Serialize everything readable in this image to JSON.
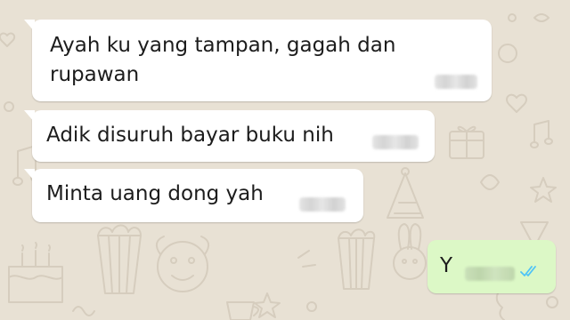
{
  "messages": [
    {
      "direction": "incoming",
      "text": "Ayah ku yang tampan, gagah dan\nrupawan"
    },
    {
      "direction": "incoming",
      "text": "Adik disuruh bayar buku nih"
    },
    {
      "direction": "incoming",
      "text": "Minta uang dong yah"
    },
    {
      "direction": "outgoing",
      "text": "Y",
      "status_icon": "double-check-read-icon"
    }
  ],
  "colors": {
    "wallpaper": "#e8e1d4",
    "incoming_bubble": "#ffffff",
    "outgoing_bubble": "#dcf8c6",
    "read_ticks": "#4fc3f7"
  }
}
